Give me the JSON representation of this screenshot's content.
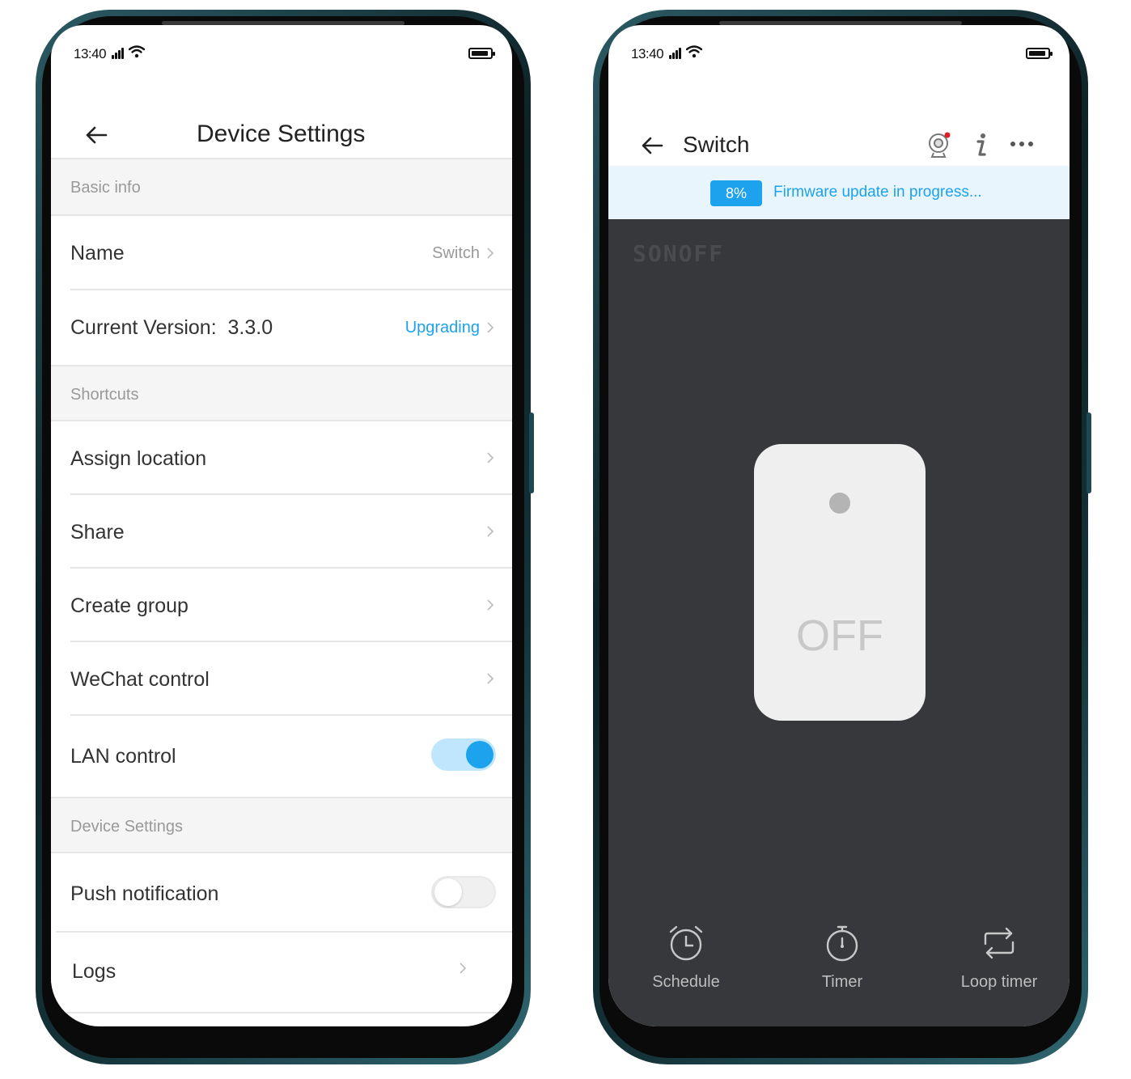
{
  "status_bar": {
    "time": "13:40"
  },
  "left_screen": {
    "title": "Device Settings",
    "sections": {
      "basic_info": "Basic info",
      "shortcuts": "Shortcuts",
      "device_settings": "Device Settings"
    },
    "rows": {
      "name": {
        "label": "Name",
        "value": "Switch"
      },
      "version": {
        "label": "Current Version:  3.3.0",
        "value": "Upgrading"
      },
      "assign_location": {
        "label": "Assign location"
      },
      "share": {
        "label": "Share"
      },
      "create_group": {
        "label": "Create group"
      },
      "wechat_control": {
        "label": "WeChat control"
      },
      "lan_control": {
        "label": "LAN control",
        "enabled": true
      },
      "push_notification": {
        "label": "Push notification",
        "enabled": false
      },
      "logs": {
        "label": "Logs"
      }
    },
    "colors": {
      "accent": "#1da2ee",
      "section_bg": "#f5f5f5"
    }
  },
  "right_screen": {
    "title": "Switch",
    "firmware": {
      "percent": "8%",
      "message": "Firmware update in progress..."
    },
    "brand_logo": "SONOFF",
    "switch_state": "OFF",
    "bottom_actions": {
      "schedule": "Schedule",
      "timer": "Timer",
      "loop_timer": "Loop timer"
    },
    "icons": [
      "camera-icon",
      "info-icon",
      "more-icon"
    ],
    "colors": {
      "dark_bg": "#37383b",
      "banner_bg": "#e9f5fc",
      "accent": "#1da2ee"
    }
  }
}
